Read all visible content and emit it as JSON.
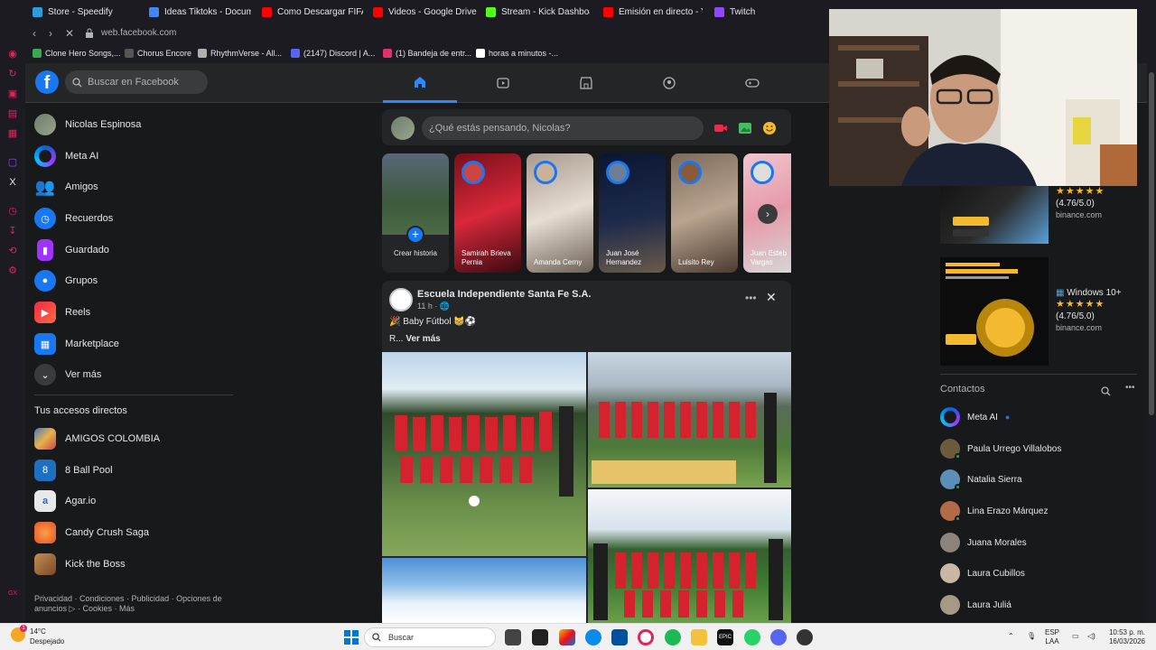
{
  "browser": {
    "tabs": [
      {
        "label": "Store - Speedify",
        "color": "#2d9cdb"
      },
      {
        "label": "Ideas Tiktoks - Documen",
        "color": "#4285f4"
      },
      {
        "label": "Como Descargar FIFA 14",
        "color": "#ff0000"
      },
      {
        "label": "Videos - Google Drive",
        "color": "#ff0000"
      },
      {
        "label": "Stream - Kick Dashboard",
        "color": "#53fc18"
      },
      {
        "label": "Emisión en directo - YouT",
        "color": "#ff0000"
      },
      {
        "label": "Twitch",
        "color": "#9146ff"
      }
    ],
    "url": "web.facebook.com",
    "bookmarks": [
      {
        "label": "Clone Hero Songs,...",
        "color": "#3aa757"
      },
      {
        "label": "Chorus Encore",
        "color": "#555"
      },
      {
        "label": "RhythmVerse - All...",
        "color": "#b0b0b0"
      },
      {
        "label": "(2147) Discord | A...",
        "color": "#5865f2"
      },
      {
        "label": "(1) Bandeja de entr...",
        "color": "#e1306c"
      },
      {
        "label": "horas a minutos -...",
        "color": "#ffffff"
      }
    ]
  },
  "facebook": {
    "search_placeholder": "Buscar en Facebook",
    "composer_placeholder": "¿Qué estás pensando, Nicolas?",
    "left_nav": [
      {
        "label": "Nicolas Espinosa",
        "icon": "avatar",
        "color": "#7d8a72"
      },
      {
        "label": "Meta AI",
        "icon": "meta-ai-icon",
        "color": "#0064e0"
      },
      {
        "label": "Amigos",
        "icon": "friends-icon",
        "color": "#1877f2"
      },
      {
        "label": "Recuerdos",
        "icon": "memories-icon",
        "color": "#1877f2"
      },
      {
        "label": "Guardado",
        "icon": "saved-icon",
        "color": "#a033ff"
      },
      {
        "label": "Grupos",
        "icon": "groups-icon",
        "color": "#1877f2"
      },
      {
        "label": "Reels",
        "icon": "reels-icon",
        "color": "#f02849"
      },
      {
        "label": "Marketplace",
        "icon": "marketplace-icon",
        "color": "#1877f2"
      },
      {
        "label": "Ver más",
        "icon": "chevron-down-icon",
        "color": "#3a3b3c"
      }
    ],
    "shortcuts_title": "Tus accesos directos",
    "shortcuts": [
      {
        "label": "AMIGOS COLOMBIA",
        "color": "#4a78c2"
      },
      {
        "label": "8 Ball Pool",
        "color": "#1d6fbf"
      },
      {
        "label": "Agar.io",
        "color": "#e8e8e8"
      },
      {
        "label": "Candy Crush Saga",
        "color": "#e3522c"
      },
      {
        "label": "Kick the Boss",
        "color": "#c58b52"
      }
    ],
    "footer": "Privacidad · Condiciones · Publicidad · Opciones de anuncios ▷ · Cookies · Más",
    "create_story": "Crear historia",
    "stories": [
      {
        "name": "Samirah Brieva Pernia",
        "bg": "linear-gradient(160deg,#7a0f1a,#d8283a 50%,#3a0a10)"
      },
      {
        "name": "Amanda Cerny",
        "bg": "linear-gradient(160deg,#a89a8e,#e7ddd2 50%,#6d6158)"
      },
      {
        "name": "Juan José Hernandez",
        "bg": "linear-gradient(170deg,#0a1633,#1e2a4a 55%,#6a5a4a)"
      },
      {
        "name": "Luisito Rey",
        "bg": "linear-gradient(160deg,#7c6b5c,#b9a48f 50%,#4a3b30)"
      },
      {
        "name": "Juan Esteb Vargas",
        "bg": "linear-gradient(160deg,#f0c5cf,#e69aa9 50%,#d6d6d6)"
      }
    ],
    "post": {
      "author": "Escuela Independiente Santa Fe S.A.",
      "time": "11 h · 🌐",
      "text": "🎉 Baby Fútbol 😸⚽",
      "more_prefix": "R... ",
      "more_link": "Ver más"
    },
    "ads": [
      {
        "title": "",
        "rating": "(4.76/5.0)",
        "domain": "binance.com"
      },
      {
        "title": "Windows 10+",
        "rating": "(4.76/5.0)",
        "domain": "binance.com"
      }
    ],
    "contacts_title": "Contactos",
    "contacts": [
      {
        "name": "Meta AI",
        "color": "#5a4cf0",
        "online": false
      },
      {
        "name": "Paula Urrego Villalobos",
        "color": "#6b5a3c",
        "online": true
      },
      {
        "name": "Natalia Sierra",
        "color": "#5c8fb8",
        "online": true
      },
      {
        "name": "Lina Erazo Márquez",
        "color": "#b36a47",
        "online": true
      },
      {
        "name": "Juana Morales",
        "color": "#8c8478",
        "online": false
      },
      {
        "name": "Laura Cubillos",
        "color": "#c9b7a6",
        "online": false
      },
      {
        "name": "Laura Juliá",
        "color": "#a49a86",
        "online": false
      }
    ]
  },
  "taskbar": {
    "temp": "14°C",
    "weather": "Despejado",
    "search": "Buscar",
    "lang": "ESP",
    "region": "LAA",
    "time": "10:53 p. m.",
    "date": "16/03/2026"
  }
}
